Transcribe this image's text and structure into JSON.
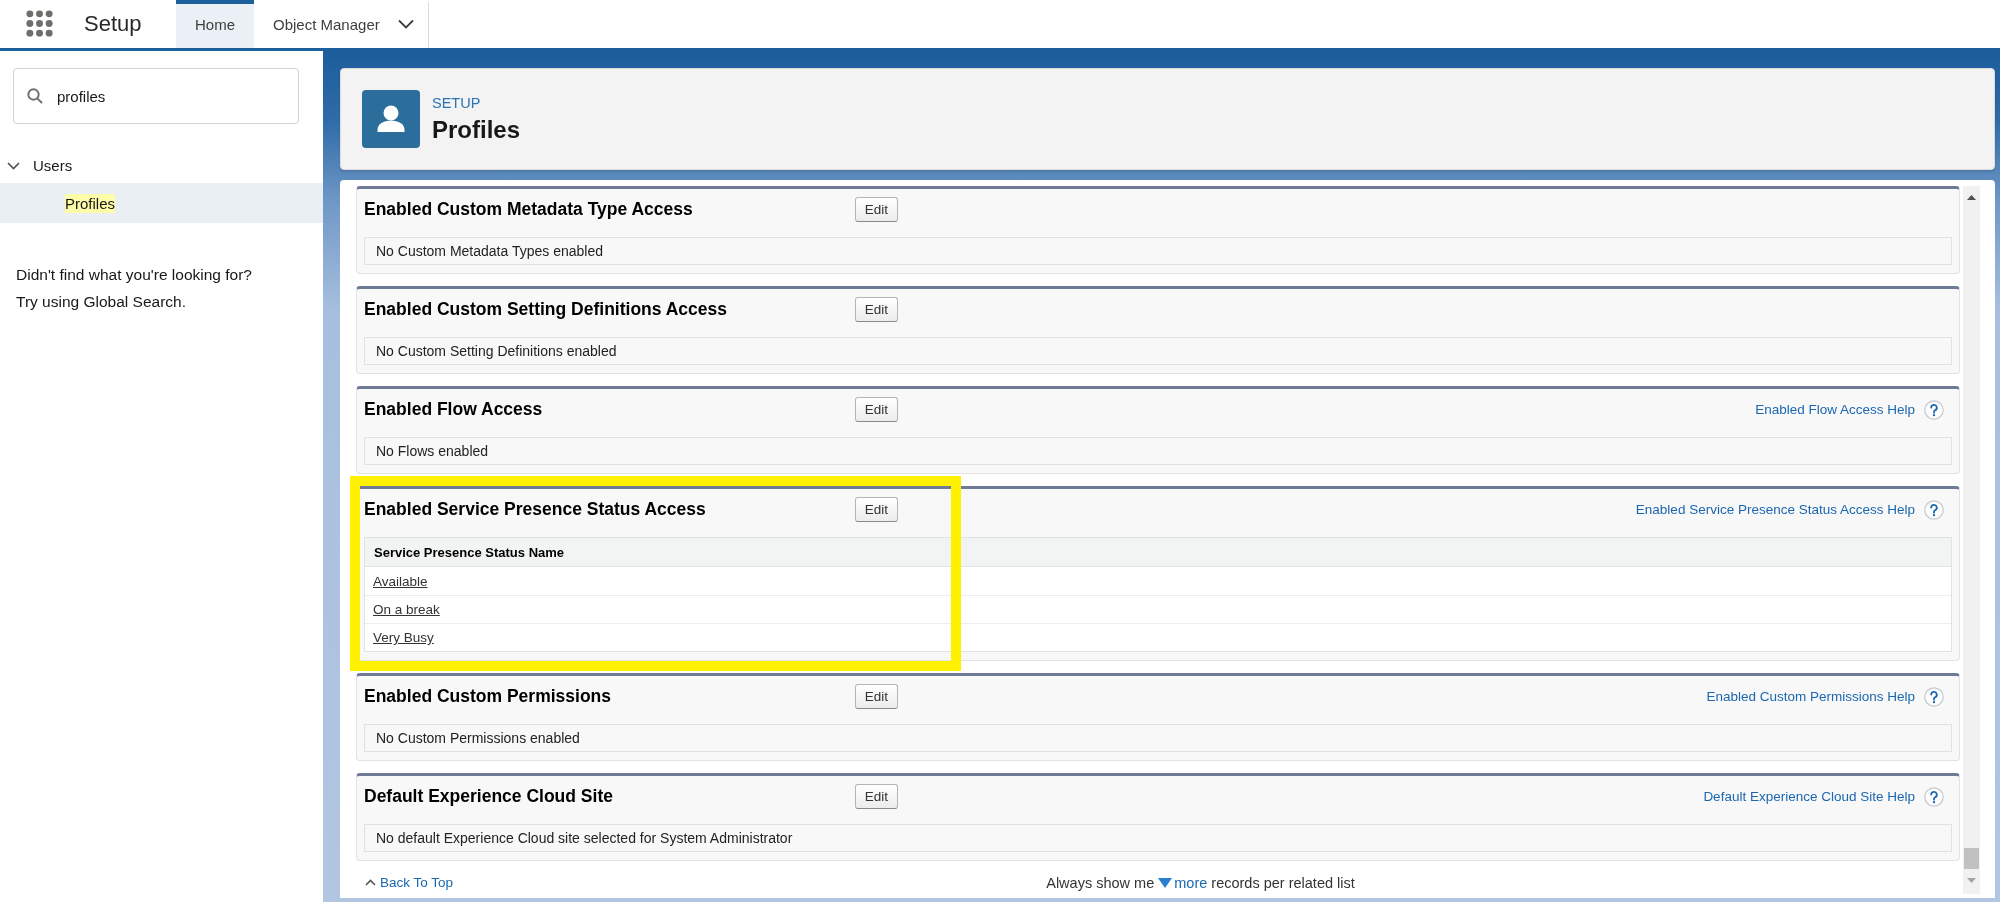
{
  "global_header": {
    "app_name": "Setup",
    "tabs": [
      {
        "label": "Home",
        "selected": true,
        "has_menu": false
      },
      {
        "label": "Object Manager",
        "selected": false,
        "has_menu": true
      }
    ]
  },
  "sidebar": {
    "search": {
      "value": "profiles"
    },
    "tree": [
      {
        "label": "Users",
        "expanded": true,
        "selected": false,
        "search_match": false,
        "children": [
          {
            "label": "Profiles",
            "selected": true,
            "search_match": true
          }
        ]
      }
    ],
    "help_text": [
      "Didn't find what you're looking for?",
      "Try using Global Search."
    ]
  },
  "page_header": {
    "eyebrow": "SETUP",
    "title": "Profiles"
  },
  "sections": [
    {
      "kind": "message",
      "title": "Enabled Custom Metadata Type Access",
      "button": "Edit",
      "highlighted": false,
      "message": "No Custom Metadata Types enabled"
    },
    {
      "kind": "message",
      "title": "Enabled Custom Setting Definitions Access",
      "button": "Edit",
      "highlighted": false,
      "message": "No Custom Setting Definitions enabled"
    },
    {
      "kind": "message",
      "title": "Enabled Flow Access",
      "button": "Edit",
      "help_link": "Enabled Flow Access Help",
      "highlighted": false,
      "message": "No Flows enabled"
    },
    {
      "kind": "table",
      "title": "Enabled Service Presence Status Access",
      "button": "Edit",
      "help_link": "Enabled Service Presence Status Access Help",
      "highlighted": true,
      "columns": [
        "Service Presence Status Name"
      ],
      "rows": [
        [
          "Available"
        ],
        [
          "On a break"
        ],
        [
          "Very Busy"
        ]
      ]
    },
    {
      "kind": "message",
      "title": "Enabled Custom Permissions",
      "button": "Edit",
      "help_link": "Enabled Custom Permissions Help",
      "highlighted": false,
      "message": "No Custom Permissions enabled"
    },
    {
      "kind": "message",
      "title": "Default Experience Cloud Site",
      "button": "Edit",
      "help_link": "Default Experience Cloud Site Help",
      "highlighted": false,
      "message": "No default Experience Cloud site selected for System Administrator"
    }
  ],
  "footer": {
    "back_to_top": "Back To Top",
    "records_setting": {
      "before": "Always show me",
      "link": "more",
      "after": "records per related list"
    }
  }
}
